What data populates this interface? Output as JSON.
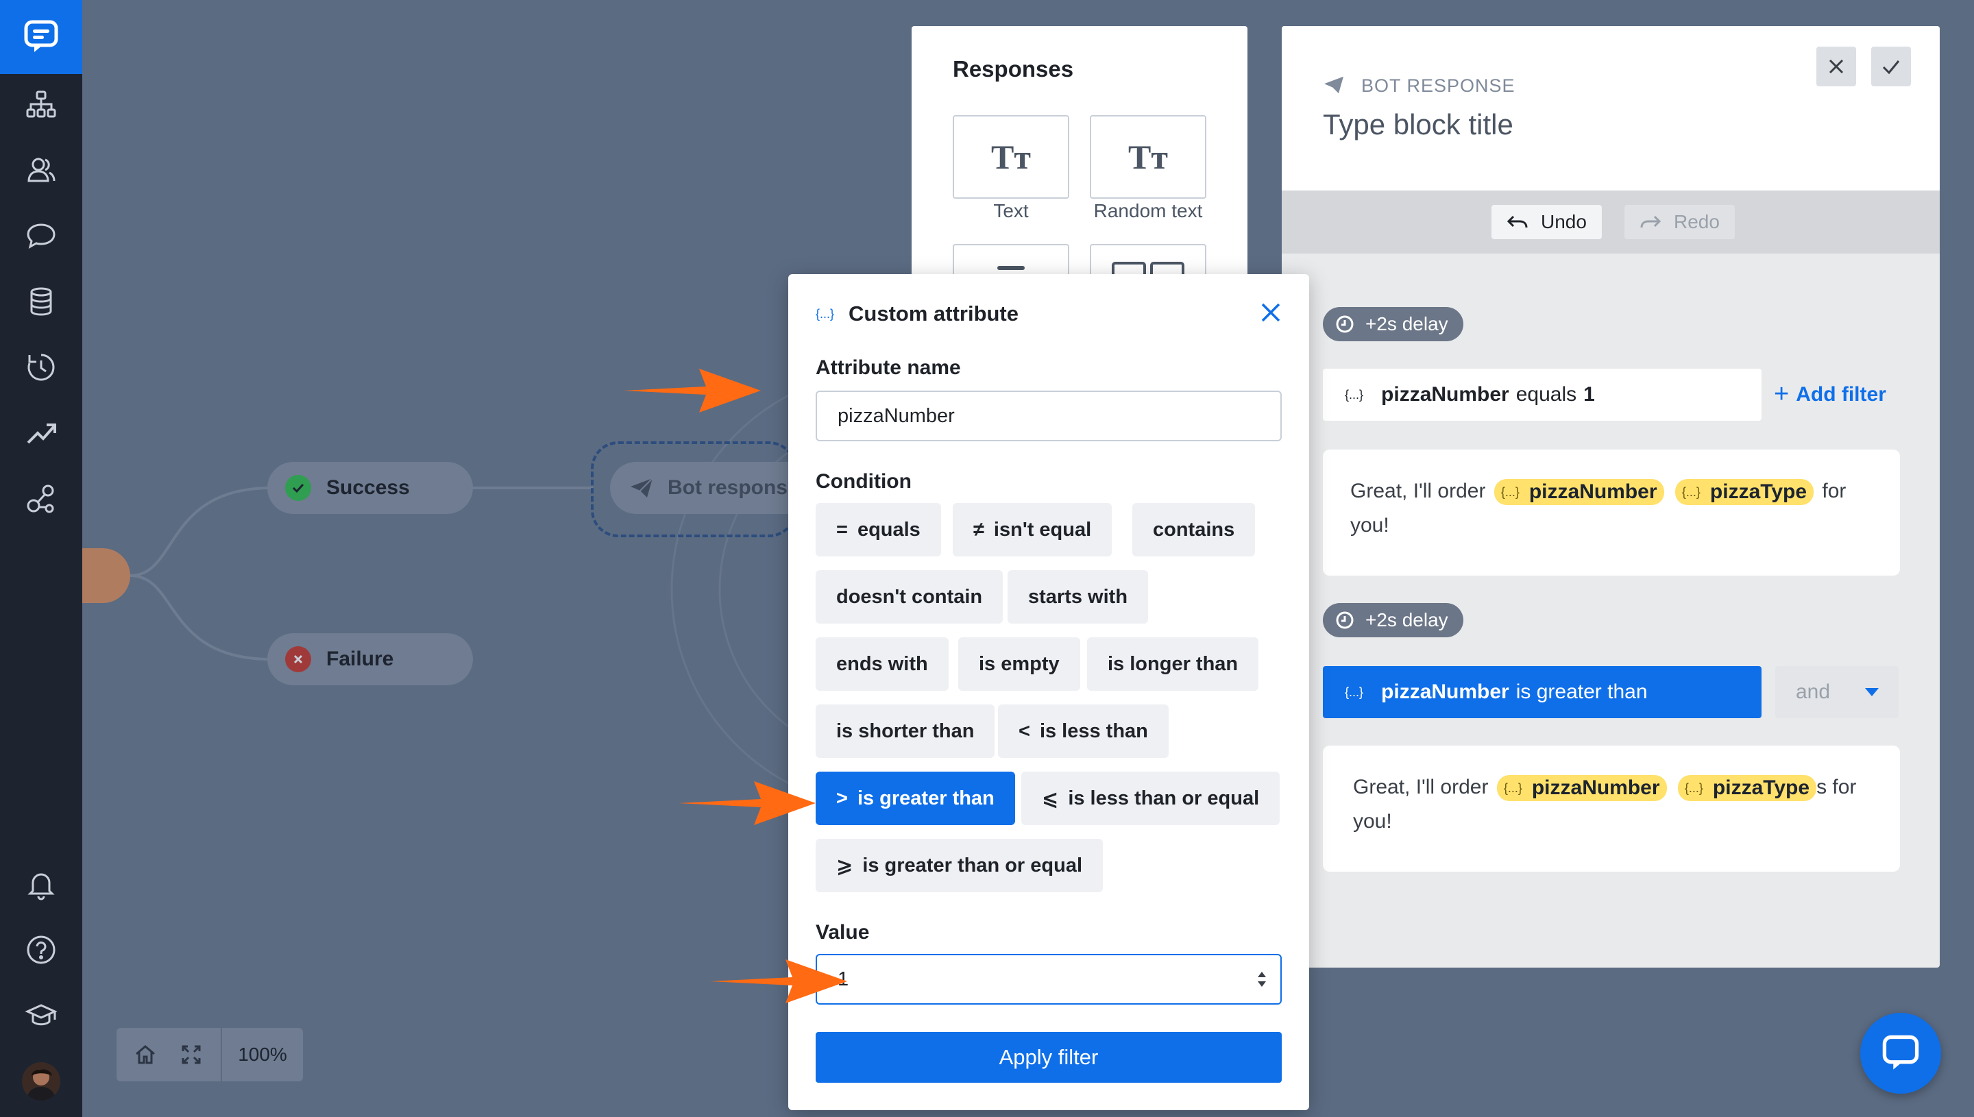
{
  "sidebar": {
    "items": [
      {
        "icon": "sitemap-icon"
      },
      {
        "icon": "users-icon"
      },
      {
        "icon": "chat-bubble-icon"
      },
      {
        "icon": "database-icon"
      },
      {
        "icon": "history-icon"
      },
      {
        "icon": "trend-icon"
      },
      {
        "icon": "integrations-icon"
      }
    ],
    "bottom": [
      {
        "icon": "bell-icon"
      },
      {
        "icon": "help-icon"
      },
      {
        "icon": "academy-icon"
      },
      {
        "icon": "avatar"
      }
    ]
  },
  "canvas": {
    "success_label": "Success",
    "failure_label": "Failure",
    "bot_node_label": "Bot response",
    "zoom_level": "100%"
  },
  "responses": {
    "title": "Responses",
    "tiles": [
      {
        "label": "Text",
        "glyph": "Tт"
      },
      {
        "label": "Random text",
        "glyph": "Tт"
      }
    ]
  },
  "bot_panel": {
    "kicker": "BOT RESPONSE",
    "title_placeholder": "Type block title",
    "undo_label": "Undo",
    "redo_label": "Redo",
    "blocks": [
      {
        "delay": "+2s delay",
        "filter": {
          "attr": "pizzaNumber",
          "op": "equals",
          "value": "1"
        },
        "add_filter": "Add filter",
        "msg_prefix": "Great, I'll order",
        "chips": [
          "pizzaNumber",
          "pizzaType"
        ],
        "msg_suffix": "for",
        "msg_line2": "you!"
      },
      {
        "delay": "+2s delay",
        "filter": {
          "attr": "pizzaNumber",
          "op": "is greater than"
        },
        "joiner": "and",
        "msg_prefix": "Great, I'll order",
        "chips": [
          "pizzaNumber",
          "pizzaType"
        ],
        "msg_suffix": "s for",
        "msg_line2": "you!"
      }
    ]
  },
  "modal": {
    "title": "Custom attribute",
    "attr_label": "Attribute name",
    "attr_value": "pizzaNumber",
    "condition_label": "Condition",
    "conditions": [
      {
        "sym": "=",
        "label": "equals"
      },
      {
        "sym": "≠",
        "label": "isn't equal"
      },
      {
        "sym": "",
        "label": "contains"
      },
      {
        "sym": "",
        "label": "doesn't contain"
      },
      {
        "sym": "",
        "label": "starts with"
      },
      {
        "sym": "",
        "label": "ends with"
      },
      {
        "sym": "",
        "label": "is empty"
      },
      {
        "sym": "",
        "label": "is longer than"
      },
      {
        "sym": "",
        "label": "is shorter than"
      },
      {
        "sym": "<",
        "label": "is less than"
      },
      {
        "sym": ">",
        "label": "is greater than",
        "selected": true
      },
      {
        "sym": "⩽",
        "label": "is less than or equal"
      },
      {
        "sym": "⩾",
        "label": "is greater than or equal"
      }
    ],
    "value_label": "Value",
    "value": "1",
    "apply_label": "Apply filter"
  },
  "colors": {
    "accent": "#0f6fe9",
    "sidebar": "#1d2430",
    "overlay": "#5b6b82",
    "chip": "#ffe16b",
    "arrow": "#ff6a13"
  }
}
